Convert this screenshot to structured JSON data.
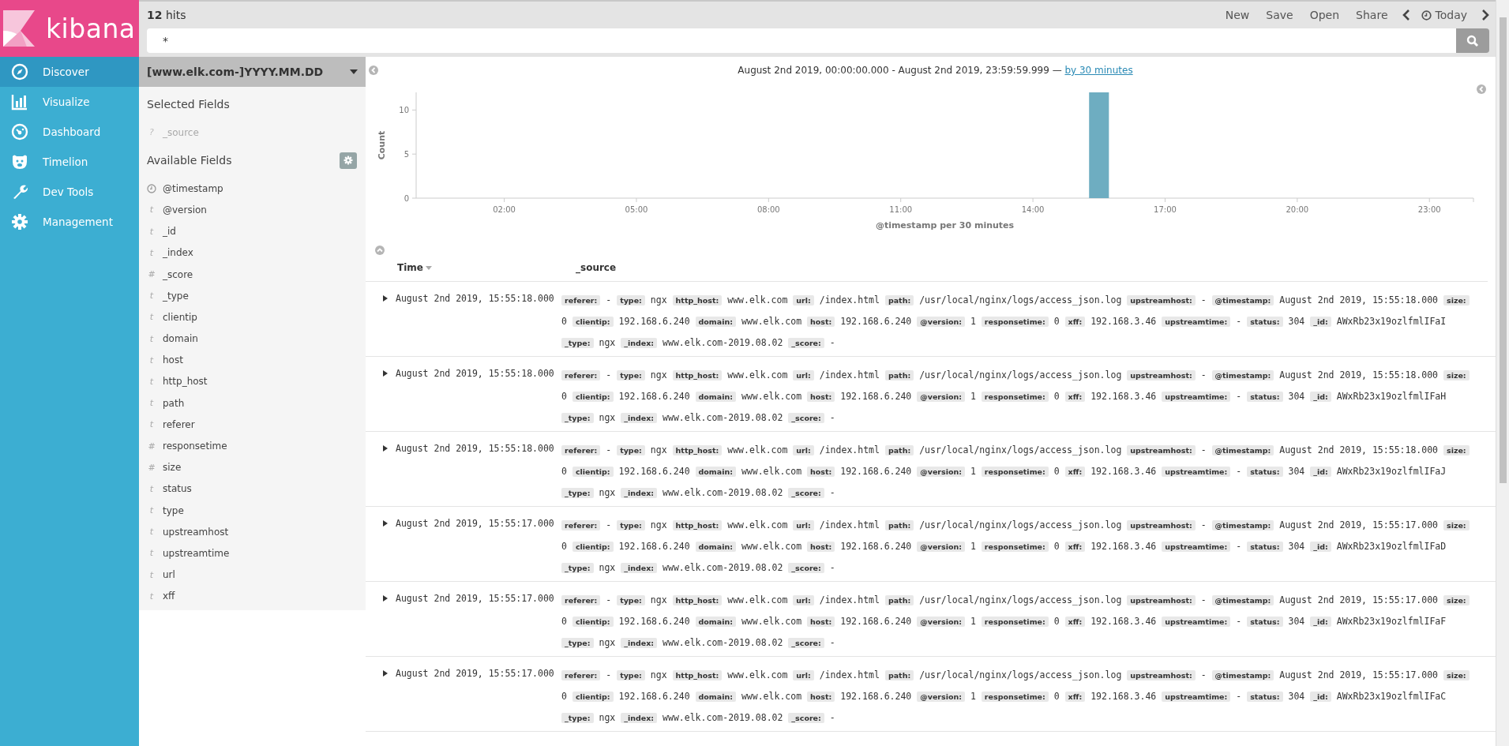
{
  "brand": {
    "name": "kibana"
  },
  "nav": [
    {
      "label": "Discover",
      "kind": "compass",
      "selected": true
    },
    {
      "label": "Visualize",
      "kind": "barchart",
      "selected": false
    },
    {
      "label": "Dashboard",
      "kind": "gauge",
      "selected": false
    },
    {
      "label": "Timelion",
      "kind": "bear",
      "selected": false
    },
    {
      "label": "Dev Tools",
      "kind": "wrench",
      "selected": false
    },
    {
      "label": "Management",
      "kind": "gear",
      "selected": false
    }
  ],
  "top_bar": {
    "hits": "12",
    "hits_label": "hits",
    "actions": [
      "New",
      "Save",
      "Open",
      "Share"
    ],
    "time_label": "Today"
  },
  "search": {
    "value": "*"
  },
  "index_pattern": "[www.elk.com-]YYYY.MM.DD",
  "selected_fields": {
    "title": "Selected Fields",
    "items": [
      {
        "name": "_source",
        "kind": "unknown",
        "type": "?"
      }
    ]
  },
  "available_fields": {
    "title": "Available Fields",
    "items": [
      {
        "name": "@timestamp",
        "kind": "date"
      },
      {
        "name": "@version",
        "kind": "string",
        "type": "t"
      },
      {
        "name": "_id",
        "kind": "string",
        "type": "t"
      },
      {
        "name": "_index",
        "kind": "string",
        "type": "t"
      },
      {
        "name": "_score",
        "kind": "number",
        "type": "#"
      },
      {
        "name": "_type",
        "kind": "string",
        "type": "t"
      },
      {
        "name": "clientip",
        "kind": "string",
        "type": "t"
      },
      {
        "name": "domain",
        "kind": "string",
        "type": "t"
      },
      {
        "name": "host",
        "kind": "string",
        "type": "t"
      },
      {
        "name": "http_host",
        "kind": "string",
        "type": "t"
      },
      {
        "name": "path",
        "kind": "string",
        "type": "t"
      },
      {
        "name": "referer",
        "kind": "string",
        "type": "t"
      },
      {
        "name": "responsetime",
        "kind": "number",
        "type": "#"
      },
      {
        "name": "size",
        "kind": "number",
        "type": "#"
      },
      {
        "name": "status",
        "kind": "string",
        "type": "t"
      },
      {
        "name": "type",
        "kind": "string",
        "type": "t"
      },
      {
        "name": "upstreamhost",
        "kind": "string",
        "type": "t"
      },
      {
        "name": "upstreamtime",
        "kind": "string",
        "type": "t"
      },
      {
        "name": "url",
        "kind": "string",
        "type": "t"
      },
      {
        "name": "xff",
        "kind": "string",
        "type": "t"
      }
    ]
  },
  "histogram": {
    "range": "August 2nd 2019, 00:00:00.000 - August 2nd 2019, 23:59:59.999 —",
    "interval": "by 30 minutes",
    "chart_data": {
      "type": "bar",
      "xlabel": "@timestamp per 30 minutes",
      "ylabel": "Count",
      "x": [
        15.5
      ],
      "values": [
        12
      ],
      "xlim": [
        0,
        24
      ],
      "ylim": [
        0,
        12
      ],
      "yticks": [
        0,
        5,
        10
      ],
      "xticks": [
        {
          "value": 2,
          "label": "02:00"
        },
        {
          "value": 5,
          "label": "05:00"
        },
        {
          "value": 8,
          "label": "08:00"
        },
        {
          "value": 11,
          "label": "11:00"
        },
        {
          "value": 14,
          "label": "14:00"
        },
        {
          "value": 17,
          "label": "17:00"
        },
        {
          "value": 20,
          "label": "20:00"
        },
        {
          "value": 23,
          "label": "23:00"
        }
      ]
    }
  },
  "table": {
    "columns": [
      "Time",
      "_source"
    ],
    "rows": [
      {
        "time": "August 2nd 2019, 15:55:18.000",
        "fields": [
          {
            "key": "referer:",
            "value": "-"
          },
          {
            "key": "type:",
            "value": "ngx"
          },
          {
            "key": "http_host:",
            "value": "www.elk.com"
          },
          {
            "key": "url:",
            "value": "/index.html"
          },
          {
            "key": "path:",
            "value": "/usr/local/nginx/logs/access_json.log"
          },
          {
            "key": "upstreamhost:",
            "value": "-"
          },
          {
            "key": "@timestamp:",
            "value": "August 2nd 2019, 15:55:18.000"
          },
          {
            "key": "size:",
            "value": "0"
          },
          {
            "key": "clientip:",
            "value": "192.168.6.240"
          },
          {
            "key": "domain:",
            "value": "www.elk.com"
          },
          {
            "key": "host:",
            "value": "192.168.6.240"
          },
          {
            "key": "@version:",
            "value": "1"
          },
          {
            "key": "responsetime:",
            "value": "0"
          },
          {
            "key": "xff:",
            "value": "192.168.3.46"
          },
          {
            "key": "upstreamtime:",
            "value": "-"
          },
          {
            "key": "status:",
            "value": "304"
          },
          {
            "key": "_id:",
            "value": "AWxRb23x19ozlfmlIFaI"
          },
          {
            "key": "_type:",
            "value": "ngx"
          },
          {
            "key": "_index:",
            "value": "www.elk.com-2019.08.02"
          },
          {
            "key": "_score:",
            "value": "-"
          }
        ]
      },
      {
        "time": "August 2nd 2019, 15:55:18.000",
        "fields": [
          {
            "key": "referer:",
            "value": "-"
          },
          {
            "key": "type:",
            "value": "ngx"
          },
          {
            "key": "http_host:",
            "value": "www.elk.com"
          },
          {
            "key": "url:",
            "value": "/index.html"
          },
          {
            "key": "path:",
            "value": "/usr/local/nginx/logs/access_json.log"
          },
          {
            "key": "upstreamhost:",
            "value": "-"
          },
          {
            "key": "@timestamp:",
            "value": "August 2nd 2019, 15:55:18.000"
          },
          {
            "key": "size:",
            "value": "0"
          },
          {
            "key": "clientip:",
            "value": "192.168.6.240"
          },
          {
            "key": "domain:",
            "value": "www.elk.com"
          },
          {
            "key": "host:",
            "value": "192.168.6.240"
          },
          {
            "key": "@version:",
            "value": "1"
          },
          {
            "key": "responsetime:",
            "value": "0"
          },
          {
            "key": "xff:",
            "value": "192.168.3.46"
          },
          {
            "key": "upstreamtime:",
            "value": "-"
          },
          {
            "key": "status:",
            "value": "304"
          },
          {
            "key": "_id:",
            "value": "AWxRb23x19ozlfmlIFaH"
          },
          {
            "key": "_type:",
            "value": "ngx"
          },
          {
            "key": "_index:",
            "value": "www.elk.com-2019.08.02"
          },
          {
            "key": "_score:",
            "value": "-"
          }
        ]
      },
      {
        "time": "August 2nd 2019, 15:55:18.000",
        "fields": [
          {
            "key": "referer:",
            "value": "-"
          },
          {
            "key": "type:",
            "value": "ngx"
          },
          {
            "key": "http_host:",
            "value": "www.elk.com"
          },
          {
            "key": "url:",
            "value": "/index.html"
          },
          {
            "key": "path:",
            "value": "/usr/local/nginx/logs/access_json.log"
          },
          {
            "key": "upstreamhost:",
            "value": "-"
          },
          {
            "key": "@timestamp:",
            "value": "August 2nd 2019, 15:55:18.000"
          },
          {
            "key": "size:",
            "value": "0"
          },
          {
            "key": "clientip:",
            "value": "192.168.6.240"
          },
          {
            "key": "domain:",
            "value": "www.elk.com"
          },
          {
            "key": "host:",
            "value": "192.168.6.240"
          },
          {
            "key": "@version:",
            "value": "1"
          },
          {
            "key": "responsetime:",
            "value": "0"
          },
          {
            "key": "xff:",
            "value": "192.168.3.46"
          },
          {
            "key": "upstreamtime:",
            "value": "-"
          },
          {
            "key": "status:",
            "value": "304"
          },
          {
            "key": "_id:",
            "value": "AWxRb23x19ozlfmlIFaJ"
          },
          {
            "key": "_type:",
            "value": "ngx"
          },
          {
            "key": "_index:",
            "value": "www.elk.com-2019.08.02"
          },
          {
            "key": "_score:",
            "value": "-"
          }
        ]
      },
      {
        "time": "August 2nd 2019, 15:55:17.000",
        "fields": [
          {
            "key": "referer:",
            "value": "-"
          },
          {
            "key": "type:",
            "value": "ngx"
          },
          {
            "key": "http_host:",
            "value": "www.elk.com"
          },
          {
            "key": "url:",
            "value": "/index.html"
          },
          {
            "key": "path:",
            "value": "/usr/local/nginx/logs/access_json.log"
          },
          {
            "key": "upstreamhost:",
            "value": "-"
          },
          {
            "key": "@timestamp:",
            "value": "August 2nd 2019, 15:55:17.000"
          },
          {
            "key": "size:",
            "value": "0"
          },
          {
            "key": "clientip:",
            "value": "192.168.6.240"
          },
          {
            "key": "domain:",
            "value": "www.elk.com"
          },
          {
            "key": "host:",
            "value": "192.168.6.240"
          },
          {
            "key": "@version:",
            "value": "1"
          },
          {
            "key": "responsetime:",
            "value": "0"
          },
          {
            "key": "xff:",
            "value": "192.168.3.46"
          },
          {
            "key": "upstreamtime:",
            "value": "-"
          },
          {
            "key": "status:",
            "value": "304"
          },
          {
            "key": "_id:",
            "value": "AWxRb23x19ozlfmlIFaD"
          },
          {
            "key": "_type:",
            "value": "ngx"
          },
          {
            "key": "_index:",
            "value": "www.elk.com-2019.08.02"
          },
          {
            "key": "_score:",
            "value": "-"
          }
        ]
      },
      {
        "time": "August 2nd 2019, 15:55:17.000",
        "fields": [
          {
            "key": "referer:",
            "value": "-"
          },
          {
            "key": "type:",
            "value": "ngx"
          },
          {
            "key": "http_host:",
            "value": "www.elk.com"
          },
          {
            "key": "url:",
            "value": "/index.html"
          },
          {
            "key": "path:",
            "value": "/usr/local/nginx/logs/access_json.log"
          },
          {
            "key": "upstreamhost:",
            "value": "-"
          },
          {
            "key": "@timestamp:",
            "value": "August 2nd 2019, 15:55:17.000"
          },
          {
            "key": "size:",
            "value": "0"
          },
          {
            "key": "clientip:",
            "value": "192.168.6.240"
          },
          {
            "key": "domain:",
            "value": "www.elk.com"
          },
          {
            "key": "host:",
            "value": "192.168.6.240"
          },
          {
            "key": "@version:",
            "value": "1"
          },
          {
            "key": "responsetime:",
            "value": "0"
          },
          {
            "key": "xff:",
            "value": "192.168.3.46"
          },
          {
            "key": "upstreamtime:",
            "value": "-"
          },
          {
            "key": "status:",
            "value": "304"
          },
          {
            "key": "_id:",
            "value": "AWxRb23x19ozlfmlIFaF"
          },
          {
            "key": "_type:",
            "value": "ngx"
          },
          {
            "key": "_index:",
            "value": "www.elk.com-2019.08.02"
          },
          {
            "key": "_score:",
            "value": "-"
          }
        ]
      },
      {
        "time": "August 2nd 2019, 15:55:17.000",
        "fields": [
          {
            "key": "referer:",
            "value": "-"
          },
          {
            "key": "type:",
            "value": "ngx"
          },
          {
            "key": "http_host:",
            "value": "www.elk.com"
          },
          {
            "key": "url:",
            "value": "/index.html"
          },
          {
            "key": "path:",
            "value": "/usr/local/nginx/logs/access_json.log"
          },
          {
            "key": "upstreamhost:",
            "value": "-"
          },
          {
            "key": "@timestamp:",
            "value": "August 2nd 2019, 15:55:17.000"
          },
          {
            "key": "size:",
            "value": "0"
          },
          {
            "key": "clientip:",
            "value": "192.168.6.240"
          },
          {
            "key": "domain:",
            "value": "www.elk.com"
          },
          {
            "key": "host:",
            "value": "192.168.6.240"
          },
          {
            "key": "@version:",
            "value": "1"
          },
          {
            "key": "responsetime:",
            "value": "0"
          },
          {
            "key": "xff:",
            "value": "192.168.3.46"
          },
          {
            "key": "upstreamtime:",
            "value": "-"
          },
          {
            "key": "status:",
            "value": "304"
          },
          {
            "key": "_id:",
            "value": "AWxRb23x19ozlfmlIFaC"
          },
          {
            "key": "_type:",
            "value": "ngx"
          },
          {
            "key": "_index:",
            "value": "www.elk.com-2019.08.02"
          },
          {
            "key": "_score:",
            "value": "-"
          }
        ]
      }
    ]
  }
}
